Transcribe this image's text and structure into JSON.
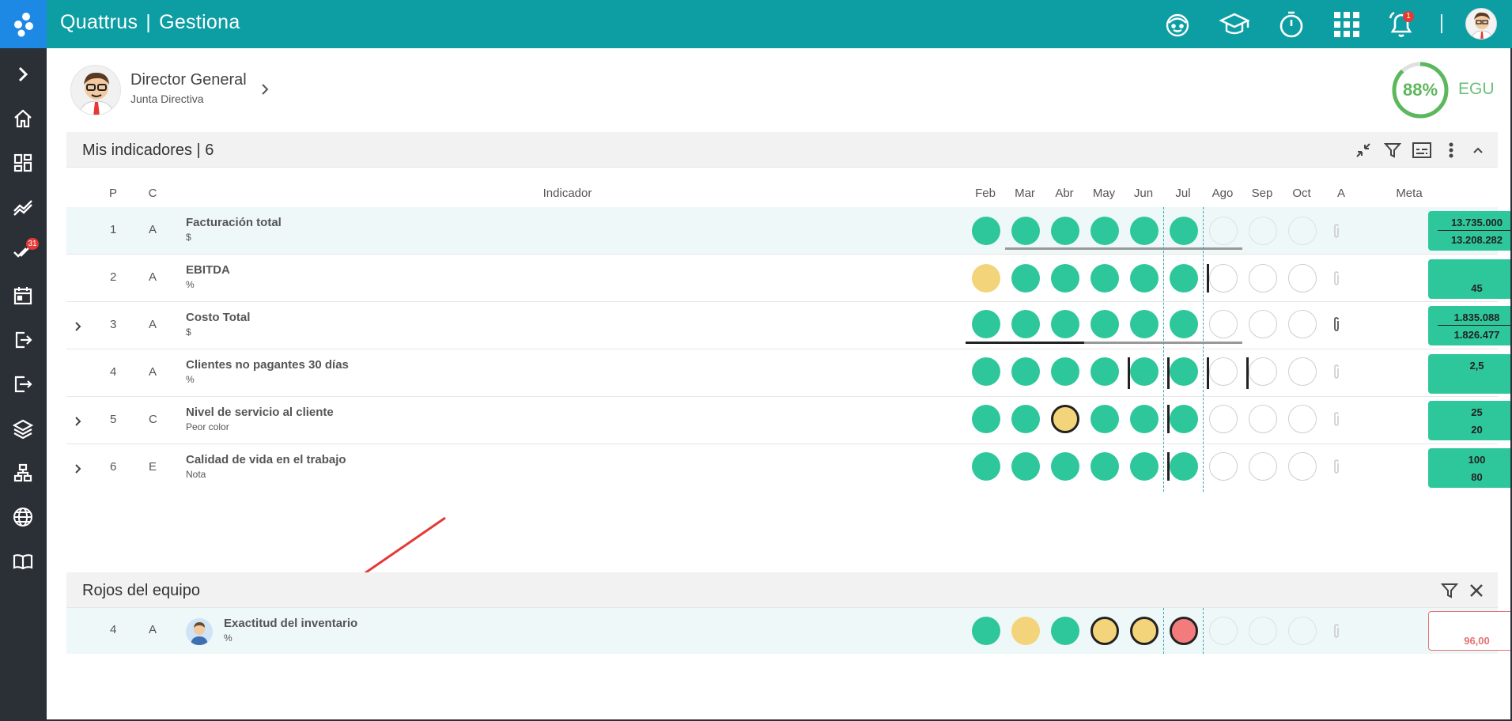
{
  "app": {
    "name": "Quattrus",
    "module": "Gestiona"
  },
  "topbar": {
    "notifications_count": "1"
  },
  "sidebar": {
    "items": [
      {
        "icon": "chevron-right-icon"
      },
      {
        "icon": "home-icon"
      },
      {
        "icon": "dashboard-icon"
      },
      {
        "icon": "trend-icon"
      },
      {
        "icon": "tasks-icon",
        "badge": "31"
      },
      {
        "icon": "calendar-icon"
      },
      {
        "icon": "logout-icon"
      },
      {
        "icon": "exit-icon"
      },
      {
        "icon": "layers-icon"
      },
      {
        "icon": "org-chart-icon"
      },
      {
        "icon": "globe-icon"
      },
      {
        "icon": "book-icon"
      }
    ]
  },
  "user": {
    "title": "Director General",
    "subtitle": "Junta Directiva",
    "score": "88%",
    "score_value": 0.88,
    "score_label": "EGU"
  },
  "indicators": {
    "title": "Mis indicadores | 6",
    "headers": {
      "p": "P",
      "c": "C",
      "indicator": "Indicador",
      "months": [
        "Feb",
        "Mar",
        "Abr",
        "May",
        "Jun",
        "Jul",
        "Ago",
        "Sep",
        "Oct"
      ],
      "a": "A",
      "meta": "Meta"
    },
    "rows": [
      {
        "p": "1",
        "c": "A",
        "name": "Facturación total",
        "unit": "$",
        "meta_top": "13.735.000",
        "meta_bottom": "13.208.282"
      },
      {
        "p": "2",
        "c": "A",
        "name": "EBITDA",
        "unit": "%",
        "meta_top": "",
        "meta_bottom": "45"
      },
      {
        "p": "3",
        "c": "A",
        "name": "Costo Total",
        "unit": "$",
        "meta_top": "1.835.088",
        "meta_bottom": "1.826.477"
      },
      {
        "p": "4",
        "c": "A",
        "name": "Clientes no pagantes 30 días",
        "unit": "%",
        "meta_top": "2,5",
        "meta_bottom": ""
      },
      {
        "p": "5",
        "c": "C",
        "name": "Nivel de servicio al cliente",
        "unit": "Peor color",
        "meta_top": "25",
        "meta_bottom": "20"
      },
      {
        "p": "6",
        "c": "E",
        "name": "Calidad de vida en el trabajo",
        "unit": "Nota",
        "meta_top": "100",
        "meta_bottom": "80"
      }
    ]
  },
  "team_reds": {
    "title": "Rojos del equipo",
    "rows": [
      {
        "p": "4",
        "c": "A",
        "name": "Exactitud del inventario",
        "unit": "%",
        "meta_bottom": "96,00"
      }
    ]
  }
}
